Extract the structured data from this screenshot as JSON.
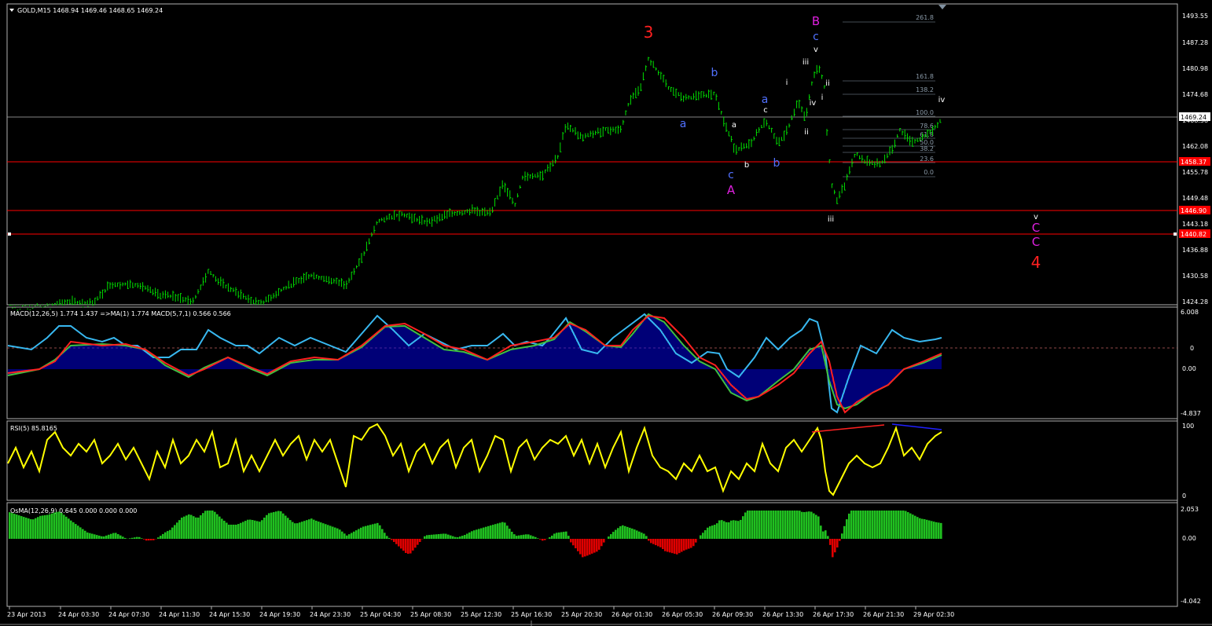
{
  "colors": {
    "background": "#000000",
    "panel_border": "#b0b0b0",
    "candle": "#00e000",
    "macd_hist": "#0000ee",
    "macd_fast": "#38b8f0",
    "macd_red": "#ff2020",
    "macd_green": "#40c040",
    "rsi_line": "#ffff00",
    "osma_pos": "#20c020",
    "osma_neg": "#e00000",
    "hline_red": "#ff0000",
    "wave_blue": "#5070ff",
    "wave_magenta": "#e020e0",
    "wave_red": "#ff2020"
  },
  "main": {
    "header": "GOLD,M15  1468.94 1469.46 1468.65 1469.24",
    "price_axis": [
      "1493.55",
      "1487.28",
      "1480.98",
      "1474.68",
      "1468.38",
      "1462.08",
      "1455.78",
      "1449.48",
      "1443.18",
      "1436.88",
      "1430.58",
      "1424.28"
    ],
    "current_price": "1469.24",
    "hlines": [
      {
        "price": "1458.37"
      },
      {
        "price": "1446.90"
      },
      {
        "price": "1440.82"
      }
    ],
    "fib_levels": [
      "261.8",
      "161.8",
      "138.2",
      "100.0",
      "78.6",
      "61.8",
      "50.0",
      "38.2",
      "23.6",
      "0.0"
    ],
    "wave_labels": {
      "w3": "3",
      "wB": "B",
      "wBc": "c",
      "wBv": "v",
      "wb1": "b",
      "wa1": "a",
      "wa2": "a",
      "wc2": "c",
      "wA": "A",
      "wa3": "a",
      "wb3": "b",
      "wc3": "c",
      "wb4": "b",
      "wi": "i",
      "wiii": "iii",
      "wii": "ii",
      "wiv": "iv",
      "wi2": "i",
      "wii2": "ii",
      "wii3": "ii",
      "wiii2": "iii",
      "wiv2": "iv",
      "wv2": "v",
      "wC1": "C",
      "wC2": "C",
      "w4": "4"
    }
  },
  "macd": {
    "header": "MACD(12,26,5) 1.774 1.437  =>MA(1) 1.774  MACD(5,7,1) 0.566 0.566",
    "axis": [
      "6.008",
      "0",
      "0.00",
      "-4.837"
    ]
  },
  "rsi": {
    "header": "RSI(5) 85.8165",
    "axis": [
      "100",
      "0"
    ]
  },
  "osma": {
    "header": "OsMA(12,26,9) 0.645 0.000 0.000 0.000",
    "axis": [
      "2.053",
      "0.00",
      "-4.042"
    ]
  },
  "time_axis": [
    "23 Apr 2013",
    "24 Apr 03:30",
    "24 Apr 07:30",
    "24 Apr 11:30",
    "24 Apr 15:30",
    "24 Apr 19:30",
    "24 Apr 23:30",
    "25 Apr 04:30",
    "25 Apr 08:30",
    "25 Apr 12:30",
    "25 Apr 16:30",
    "25 Apr 20:30",
    "26 Apr 01:30",
    "26 Apr 05:30",
    "26 Apr 09:30",
    "26 Apr 13:30",
    "26 Apr 17:30",
    "26 Apr 21:30",
    "29 Apr 02:30"
  ],
  "series": {
    "price_path": [
      [
        10,
        392
      ],
      [
        60,
        392
      ],
      [
        80,
        385
      ],
      [
        120,
        385
      ],
      [
        140,
        362
      ],
      [
        175,
        362
      ],
      [
        200,
        375
      ],
      [
        225,
        378
      ],
      [
        245,
        385
      ],
      [
        265,
        345
      ],
      [
        280,
        360
      ],
      [
        300,
        372
      ],
      [
        330,
        388
      ],
      [
        360,
        368
      ],
      [
        395,
        350
      ],
      [
        440,
        362
      ],
      [
        460,
        330
      ],
      [
        480,
        282
      ],
      [
        510,
        272
      ],
      [
        540,
        283
      ],
      [
        575,
        272
      ],
      [
        600,
        268
      ],
      [
        625,
        272
      ],
      [
        640,
        232
      ],
      [
        655,
        262
      ],
      [
        665,
        225
      ],
      [
        690,
        222
      ],
      [
        710,
        200
      ],
      [
        720,
        158
      ],
      [
        740,
        175
      ],
      [
        770,
        165
      ],
      [
        790,
        165
      ],
      [
        800,
        130
      ],
      [
        815,
        110
      ],
      [
        825,
        75
      ],
      [
        840,
        95
      ],
      [
        850,
        112
      ],
      [
        870,
        125
      ],
      [
        890,
        123
      ],
      [
        910,
        118
      ],
      [
        920,
        152
      ],
      [
        935,
        190
      ],
      [
        955,
        185
      ],
      [
        965,
        165
      ],
      [
        975,
        155
      ],
      [
        990,
        182
      ],
      [
        1000,
        170
      ],
      [
        1015,
        130
      ],
      [
        1025,
        150
      ],
      [
        1035,
        95
      ],
      [
        1042,
        85
      ],
      [
        1050,
        115
      ],
      [
        1052,
        170
      ],
      [
        1058,
        235
      ],
      [
        1065,
        255
      ],
      [
        1075,
        235
      ],
      [
        1088,
        195
      ],
      [
        1100,
        205
      ],
      [
        1120,
        210
      ],
      [
        1135,
        190
      ],
      [
        1145,
        165
      ],
      [
        1160,
        182
      ],
      [
        1175,
        175
      ],
      [
        1190,
        162
      ],
      [
        1198,
        150
      ]
    ],
    "macd_blue": [
      [
        10,
        440
      ],
      [
        40,
        445
      ],
      [
        60,
        430
      ],
      [
        75,
        415
      ],
      [
        90,
        415
      ],
      [
        110,
        430
      ],
      [
        130,
        435
      ],
      [
        145,
        430
      ],
      [
        160,
        440
      ],
      [
        175,
        440
      ],
      [
        195,
        455
      ],
      [
        215,
        455
      ],
      [
        230,
        445
      ],
      [
        250,
        445
      ],
      [
        265,
        420
      ],
      [
        280,
        430
      ],
      [
        300,
        440
      ],
      [
        315,
        440
      ],
      [
        330,
        450
      ],
      [
        355,
        430
      ],
      [
        375,
        440
      ],
      [
        395,
        430
      ],
      [
        420,
        440
      ],
      [
        440,
        448
      ],
      [
        460,
        425
      ],
      [
        480,
        402
      ],
      [
        500,
        420
      ],
      [
        520,
        440
      ],
      [
        540,
        425
      ],
      [
        560,
        435
      ],
      [
        580,
        445
      ],
      [
        600,
        440
      ],
      [
        620,
        440
      ],
      [
        640,
        425
      ],
      [
        655,
        440
      ],
      [
        670,
        435
      ],
      [
        690,
        440
      ],
      [
        700,
        430
      ],
      [
        720,
        405
      ],
      [
        740,
        445
      ],
      [
        760,
        450
      ],
      [
        780,
        430
      ],
      [
        800,
        415
      ],
      [
        820,
        400
      ],
      [
        840,
        420
      ],
      [
        860,
        450
      ],
      [
        880,
        462
      ],
      [
        900,
        448
      ],
      [
        915,
        450
      ],
      [
        925,
        470
      ],
      [
        940,
        480
      ],
      [
        960,
        455
      ],
      [
        975,
        430
      ],
      [
        990,
        445
      ],
      [
        1005,
        430
      ],
      [
        1020,
        420
      ],
      [
        1030,
        406
      ],
      [
        1040,
        410
      ],
      [
        1050,
        450
      ],
      [
        1058,
        520
      ],
      [
        1065,
        525
      ],
      [
        1080,
        480
      ],
      [
        1095,
        440
      ],
      [
        1115,
        450
      ],
      [
        1135,
        420
      ],
      [
        1150,
        430
      ],
      [
        1170,
        435
      ],
      [
        1190,
        432
      ],
      [
        1198,
        430
      ]
    ],
    "macd_red": [
      [
        10,
        475
      ],
      [
        50,
        470
      ],
      [
        70,
        460
      ],
      [
        90,
        435
      ],
      [
        130,
        440
      ],
      [
        160,
        438
      ],
      [
        185,
        445
      ],
      [
        210,
        462
      ],
      [
        240,
        478
      ],
      [
        260,
        470
      ],
      [
        290,
        455
      ],
      [
        320,
        468
      ],
      [
        340,
        476
      ],
      [
        370,
        460
      ],
      [
        400,
        455
      ],
      [
        430,
        458
      ],
      [
        460,
        440
      ],
      [
        490,
        415
      ],
      [
        515,
        412
      ],
      [
        540,
        425
      ],
      [
        565,
        440
      ],
      [
        590,
        445
      ],
      [
        620,
        458
      ],
      [
        650,
        440
      ],
      [
        680,
        435
      ],
      [
        705,
        430
      ],
      [
        725,
        412
      ],
      [
        745,
        420
      ],
      [
        770,
        440
      ],
      [
        790,
        440
      ],
      [
        805,
        420
      ],
      [
        825,
        402
      ],
      [
        845,
        405
      ],
      [
        870,
        430
      ],
      [
        890,
        455
      ],
      [
        910,
        465
      ],
      [
        930,
        490
      ],
      [
        950,
        508
      ],
      [
        965,
        505
      ],
      [
        990,
        490
      ],
      [
        1010,
        475
      ],
      [
        1030,
        450
      ],
      [
        1045,
        435
      ],
      [
        1055,
        460
      ],
      [
        1065,
        505
      ],
      [
        1075,
        525
      ],
      [
        1090,
        512
      ],
      [
        1110,
        500
      ],
      [
        1130,
        490
      ],
      [
        1150,
        470
      ],
      [
        1175,
        460
      ],
      [
        1198,
        450
      ]
    ],
    "macd_green": [
      [
        10,
        478
      ],
      [
        50,
        470
      ],
      [
        70,
        458
      ],
      [
        90,
        440
      ],
      [
        130,
        438
      ],
      [
        160,
        440
      ],
      [
        185,
        445
      ],
      [
        210,
        465
      ],
      [
        240,
        480
      ],
      [
        260,
        468
      ],
      [
        290,
        455
      ],
      [
        320,
        470
      ],
      [
        340,
        478
      ],
      [
        370,
        462
      ],
      [
        400,
        458
      ],
      [
        430,
        458
      ],
      [
        460,
        442
      ],
      [
        490,
        416
      ],
      [
        515,
        415
      ],
      [
        540,
        430
      ],
      [
        565,
        445
      ],
      [
        590,
        448
      ],
      [
        620,
        458
      ],
      [
        650,
        445
      ],
      [
        680,
        440
      ],
      [
        705,
        432
      ],
      [
        725,
        410
      ],
      [
        745,
        422
      ],
      [
        770,
        440
      ],
      [
        790,
        442
      ],
      [
        805,
        425
      ],
      [
        825,
        400
      ],
      [
        845,
        410
      ],
      [
        870,
        440
      ],
      [
        890,
        460
      ],
      [
        910,
        470
      ],
      [
        930,
        500
      ],
      [
        950,
        510
      ],
      [
        965,
        505
      ],
      [
        990,
        485
      ],
      [
        1010,
        470
      ],
      [
        1030,
        445
      ],
      [
        1045,
        440
      ],
      [
        1055,
        485
      ],
      [
        1065,
        515
      ],
      [
        1075,
        520
      ],
      [
        1090,
        515
      ],
      [
        1110,
        500
      ],
      [
        1130,
        490
      ],
      [
        1150,
        470
      ],
      [
        1175,
        462
      ],
      [
        1198,
        452
      ]
    ],
    "rsi": [
      [
        10,
        590
      ],
      [
        20,
        570
      ],
      [
        30,
        595
      ],
      [
        40,
        575
      ],
      [
        50,
        600
      ],
      [
        60,
        560
      ],
      [
        70,
        550
      ],
      [
        80,
        570
      ],
      [
        90,
        580
      ],
      [
        100,
        565
      ],
      [
        110,
        575
      ],
      [
        120,
        560
      ],
      [
        130,
        590
      ],
      [
        140,
        580
      ],
      [
        150,
        565
      ],
      [
        160,
        585
      ],
      [
        170,
        570
      ],
      [
        180,
        590
      ],
      [
        190,
        610
      ],
      [
        200,
        575
      ],
      [
        210,
        595
      ],
      [
        220,
        560
      ],
      [
        230,
        590
      ],
      [
        240,
        580
      ],
      [
        250,
        560
      ],
      [
        260,
        575
      ],
      [
        270,
        550
      ],
      [
        280,
        595
      ],
      [
        290,
        590
      ],
      [
        300,
        560
      ],
      [
        310,
        600
      ],
      [
        320,
        580
      ],
      [
        330,
        600
      ],
      [
        340,
        580
      ],
      [
        350,
        560
      ],
      [
        360,
        580
      ],
      [
        370,
        565
      ],
      [
        380,
        555
      ],
      [
        390,
        585
      ],
      [
        400,
        560
      ],
      [
        410,
        575
      ],
      [
        420,
        560
      ],
      [
        430,
        590
      ],
      [
        440,
        620
      ],
      [
        450,
        555
      ],
      [
        460,
        560
      ],
      [
        470,
        545
      ],
      [
        480,
        540
      ],
      [
        490,
        555
      ],
      [
        500,
        580
      ],
      [
        510,
        565
      ],
      [
        520,
        600
      ],
      [
        530,
        575
      ],
      [
        540,
        565
      ],
      [
        550,
        590
      ],
      [
        560,
        570
      ],
      [
        570,
        560
      ],
      [
        580,
        595
      ],
      [
        590,
        570
      ],
      [
        600,
        560
      ],
      [
        610,
        600
      ],
      [
        620,
        580
      ],
      [
        630,
        555
      ],
      [
        640,
        560
      ],
      [
        650,
        600
      ],
      [
        660,
        570
      ],
      [
        670,
        560
      ],
      [
        680,
        585
      ],
      [
        690,
        570
      ],
      [
        700,
        560
      ],
      [
        710,
        565
      ],
      [
        720,
        555
      ],
      [
        730,
        580
      ],
      [
        740,
        560
      ],
      [
        750,
        590
      ],
      [
        760,
        565
      ],
      [
        770,
        595
      ],
      [
        780,
        570
      ],
      [
        790,
        550
      ],
      [
        800,
        600
      ],
      [
        810,
        570
      ],
      [
        820,
        545
      ],
      [
        830,
        580
      ],
      [
        840,
        595
      ],
      [
        850,
        600
      ],
      [
        860,
        610
      ],
      [
        870,
        590
      ],
      [
        880,
        600
      ],
      [
        890,
        580
      ],
      [
        900,
        600
      ],
      [
        910,
        595
      ],
      [
        920,
        625
      ],
      [
        930,
        600
      ],
      [
        940,
        610
      ],
      [
        950,
        590
      ],
      [
        960,
        600
      ],
      [
        970,
        565
      ],
      [
        980,
        590
      ],
      [
        990,
        600
      ],
      [
        1000,
        570
      ],
      [
        1010,
        560
      ],
      [
        1020,
        575
      ],
      [
        1030,
        560
      ],
      [
        1040,
        545
      ],
      [
        1045,
        560
      ],
      [
        1050,
        600
      ],
      [
        1055,
        625
      ],
      [
        1060,
        630
      ],
      [
        1070,
        610
      ],
      [
        1080,
        590
      ],
      [
        1090,
        580
      ],
      [
        1100,
        590
      ],
      [
        1110,
        595
      ],
      [
        1120,
        590
      ],
      [
        1130,
        570
      ],
      [
        1140,
        545
      ],
      [
        1150,
        580
      ],
      [
        1160,
        570
      ],
      [
        1170,
        585
      ],
      [
        1180,
        565
      ],
      [
        1190,
        555
      ],
      [
        1198,
        550
      ]
    ]
  }
}
